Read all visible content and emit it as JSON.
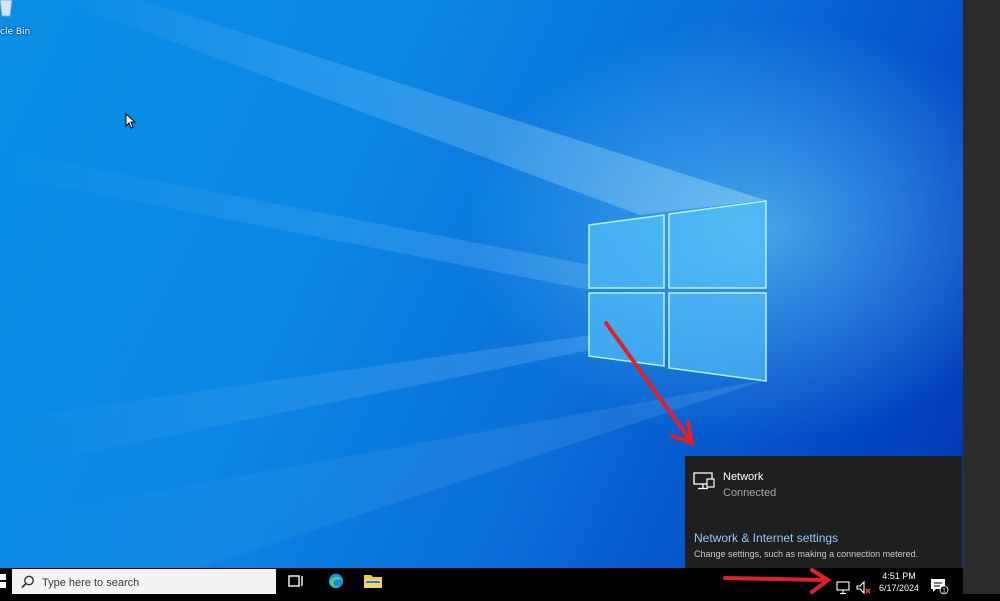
{
  "desktop": {
    "recycle_bin_label": "cle Bin"
  },
  "network_flyout": {
    "network_name": "Network",
    "network_status": "Connected",
    "settings_link": "Network & Internet settings",
    "settings_description": "Change settings, such as making a connection metered."
  },
  "taskbar": {
    "search_placeholder": "Type here to search",
    "pinned": [
      "task-view-icon",
      "edge-icon",
      "file-explorer-icon"
    ],
    "tray": {
      "network_icon": "network-icon",
      "volume_icon": "volume-muted-icon",
      "time": "4:51 PM",
      "date": "6/17/2024",
      "notification_count": "1"
    }
  },
  "annotations": {
    "arrow_color": "#e0202a"
  },
  "colors": {
    "wallpaper_blue": "#0a86e4",
    "flyout_bg": "#1f1f1f",
    "link_blue": "#8fc7ff"
  }
}
